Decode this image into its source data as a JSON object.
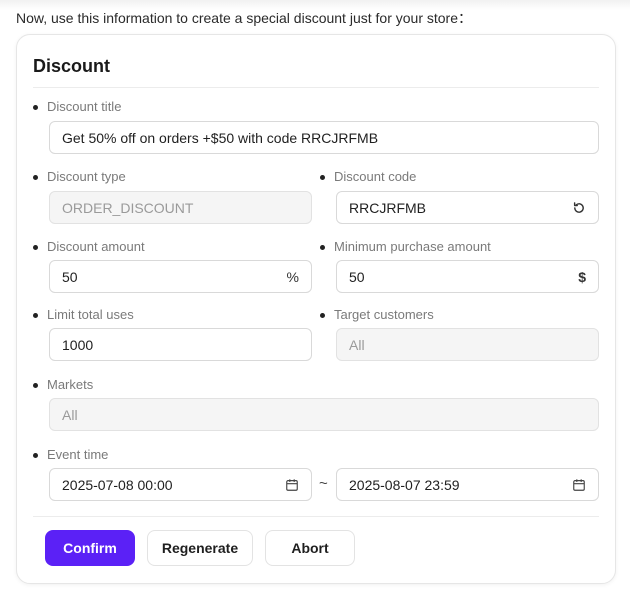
{
  "intro_text": "Now, use this information to create a special discount just for your store：",
  "card": {
    "title": "Discount"
  },
  "fields": {
    "discount_title": {
      "label": "Discount title",
      "value": "Get 50% off on orders +$50 with code RRCJRFMB"
    },
    "discount_type": {
      "label": "Discount type",
      "value": "ORDER_DISCOUNT"
    },
    "discount_code": {
      "label": "Discount code",
      "value": "RRCJRFMB"
    },
    "discount_amount": {
      "label": "Discount amount",
      "value": "50",
      "suffix": "%"
    },
    "minimum_purchase": {
      "label": "Minimum purchase amount",
      "value": "50",
      "suffix": "$"
    },
    "limit_total_uses": {
      "label": "Limit total uses",
      "value": "1000"
    },
    "target_customers": {
      "label": "Target customers",
      "value": "All"
    },
    "markets": {
      "label": "Markets",
      "value": "All"
    },
    "event_time": {
      "label": "Event time",
      "start": "2025-07-08 00:00",
      "separator": "~",
      "end": "2025-08-07 23:59"
    }
  },
  "buttons": {
    "confirm": "Confirm",
    "regenerate": "Regenerate",
    "abort": "Abort"
  },
  "colors": {
    "primary": "#5b21f6",
    "disabled_bg": "#f5f5f5",
    "border": "#d9d9d9"
  },
  "icons": {
    "discount_code_action": "refresh-icon",
    "event_start": "calendar-icon",
    "event_end": "calendar-icon"
  }
}
